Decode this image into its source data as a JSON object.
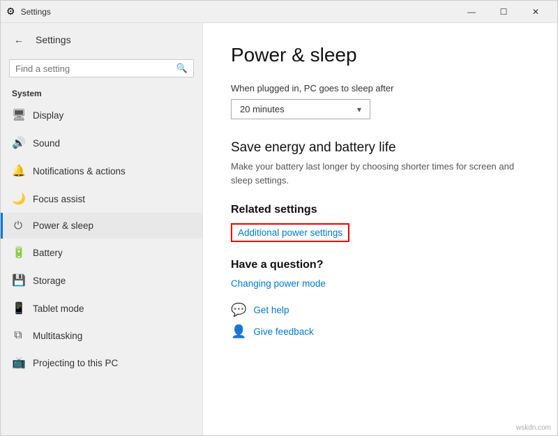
{
  "titleBar": {
    "title": "Settings",
    "minimizeLabel": "—",
    "maximizeLabel": "☐",
    "closeLabel": "✕"
  },
  "sidebar": {
    "backArrow": "←",
    "appTitle": "Settings",
    "search": {
      "placeholder": "Find a setting",
      "icon": "🔍"
    },
    "sectionTitle": "System",
    "items": [
      {
        "id": "display",
        "label": "Display",
        "icon": "🖥"
      },
      {
        "id": "sound",
        "label": "Sound",
        "icon": "🔊"
      },
      {
        "id": "notifications",
        "label": "Notifications & actions",
        "icon": "🔔"
      },
      {
        "id": "focus",
        "label": "Focus assist",
        "icon": "🌙"
      },
      {
        "id": "power",
        "label": "Power & sleep",
        "icon": "⏻",
        "active": true
      },
      {
        "id": "battery",
        "label": "Battery",
        "icon": "🔋"
      },
      {
        "id": "storage",
        "label": "Storage",
        "icon": "💾"
      },
      {
        "id": "tablet",
        "label": "Tablet mode",
        "icon": "📱"
      },
      {
        "id": "multitasking",
        "label": "Multitasking",
        "icon": "⧉"
      },
      {
        "id": "projecting",
        "label": "Projecting to this PC",
        "icon": "📺"
      }
    ]
  },
  "main": {
    "pageTitle": "Power & sleep",
    "dropdownLabel": "When plugged in, PC goes to sleep after",
    "dropdownValue": "20 minutes",
    "saveEnergy": {
      "title": "Save energy and battery life",
      "description": "Make your battery last longer by choosing shorter times for screen and sleep settings."
    },
    "relatedSettings": {
      "title": "Related settings",
      "additionalPowerLink": "Additional power settings"
    },
    "haveQuestion": {
      "title": "Have a question?",
      "changingPowerMode": "Changing power mode"
    },
    "helpLinks": [
      {
        "id": "get-help",
        "label": "Get help",
        "icon": "💬"
      },
      {
        "id": "give-feedback",
        "label": "Give feedback",
        "icon": "👤"
      }
    ]
  },
  "watermark": "wskdn.com"
}
